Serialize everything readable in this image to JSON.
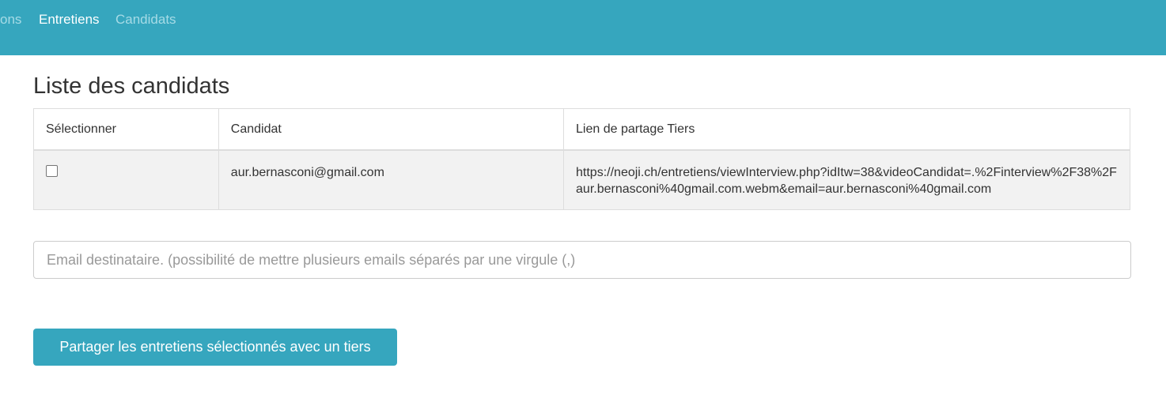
{
  "nav": {
    "items": [
      {
        "label": "ons",
        "state": "inactive"
      },
      {
        "label": "Entretiens",
        "state": "active"
      },
      {
        "label": "Candidats",
        "state": "inactive"
      }
    ]
  },
  "main": {
    "title": "Liste des candidats",
    "table": {
      "headers": [
        "Sélectionner",
        "Candidat",
        "Lien de partage Tiers"
      ],
      "rows": [
        {
          "selected": false,
          "candidate": "aur.bernasconi@gmail.com",
          "share_link": "https://neoji.ch/entretiens/viewInterview.php?idItw=38&videoCandidat=.%2Finterview%2F38%2Faur.bernasconi%40gmail.com.webm&email=aur.bernasconi%40gmail.com"
        }
      ]
    },
    "email_input": {
      "value": "",
      "placeholder": "Email destinataire. (possibilité de mettre plusieurs emails séparés par une virgule (,)"
    },
    "share_button_label": "Partager les entretiens sélectionnés avec un tiers"
  },
  "colors": {
    "accent": "#36a6be",
    "nav_inactive_text": "#a6dbe6",
    "row_background": "#f2f2f2"
  }
}
